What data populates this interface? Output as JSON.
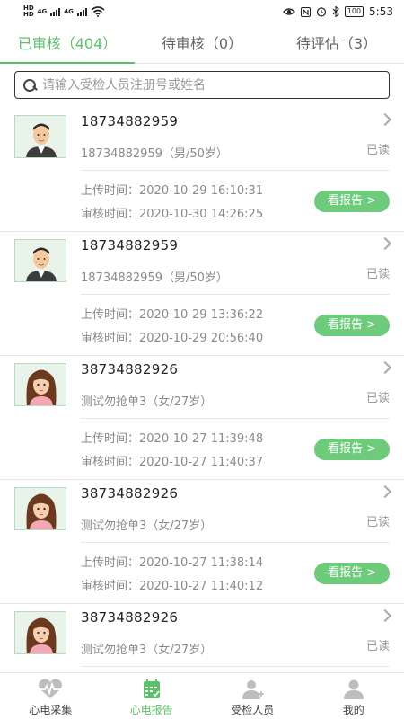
{
  "status_bar": {
    "left_tags": [
      "HD",
      "HD"
    ],
    "net_1": "4G",
    "net_2": "4G",
    "battery": "100",
    "time": "5:53"
  },
  "tabs": [
    {
      "label": "已审核（404）",
      "active": true
    },
    {
      "label": "待审核（0）",
      "active": false
    },
    {
      "label": "待评估（3）",
      "active": false
    }
  ],
  "search": {
    "placeholder": "请输入受检人员注册号或姓名",
    "value": ""
  },
  "records": [
    {
      "reg_no": "18734882959",
      "info": "18734882959（男/50岁）",
      "status": "已读",
      "upload_label": "上传时间：",
      "upload_time": "2020-10-29 16:10:31",
      "review_label": "审核时间：",
      "review_time": "2020-10-30 14:26:25",
      "button": "看报告 >",
      "avatar": "male-avatar"
    },
    {
      "reg_no": "18734882959",
      "info": "18734882959（男/50岁）",
      "status": "已读",
      "upload_label": "上传时间：",
      "upload_time": "2020-10-29 13:36:22",
      "review_label": "审核时间：",
      "review_time": "2020-10-29 20:56:40",
      "button": "看报告 >",
      "avatar": "male-avatar"
    },
    {
      "reg_no": "38734882926",
      "info": "测试勿抢单3（女/27岁）",
      "status": "已读",
      "upload_label": "上传时间：",
      "upload_time": "2020-10-27 11:39:48",
      "review_label": "审核时间：",
      "review_time": "2020-10-27 11:40:37",
      "button": "看报告 >",
      "avatar": "female-avatar"
    },
    {
      "reg_no": "38734882926",
      "info": "测试勿抢单3（女/27岁）",
      "status": "已读",
      "upload_label": "上传时间：",
      "upload_time": "2020-10-27 11:38:14",
      "review_label": "审核时间：",
      "review_time": "2020-10-27 11:40:12",
      "button": "看报告 >",
      "avatar": "female-avatar"
    },
    {
      "reg_no": "38734882926",
      "info": "测试勿抢单3（女/27岁）",
      "status": "已读",
      "upload_label": "",
      "upload_time": "",
      "review_label": "",
      "review_time": "",
      "button": "",
      "avatar": "female-avatar"
    }
  ],
  "bottom_nav": [
    {
      "label": "心电采集",
      "icon": "heartbeat-icon",
      "active": false
    },
    {
      "label": "心电报告",
      "icon": "calendar-report-icon",
      "active": true
    },
    {
      "label": "受检人员",
      "icon": "add-person-icon",
      "active": false
    },
    {
      "label": "我的",
      "icon": "person-icon",
      "active": false
    }
  ],
  "colors": {
    "accent": "#5cbf6a",
    "button": "#6ecb7b",
    "muted": "#8a8a8a"
  }
}
